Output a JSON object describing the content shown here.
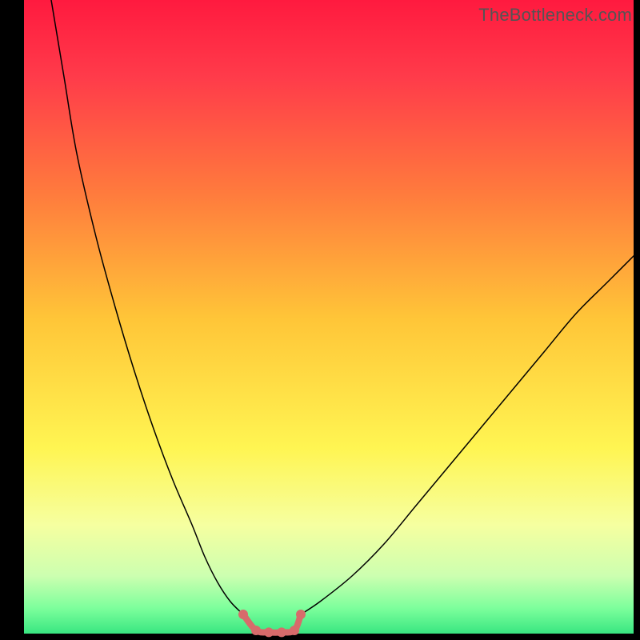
{
  "watermark": "TheBottleneck.com",
  "chart_data": {
    "type": "line",
    "title": "",
    "xlabel": "",
    "ylabel": "",
    "xlim": [
      0,
      100
    ],
    "ylim": [
      0,
      100
    ],
    "background": {
      "type": "vertical-gradient",
      "stops": [
        {
          "pos": 0.0,
          "color": "#ff1a3f"
        },
        {
          "pos": 0.12,
          "color": "#ff3b4a"
        },
        {
          "pos": 0.3,
          "color": "#ff7a3d"
        },
        {
          "pos": 0.5,
          "color": "#ffc638"
        },
        {
          "pos": 0.7,
          "color": "#fff552"
        },
        {
          "pos": 0.82,
          "color": "#f6ffa0"
        },
        {
          "pos": 0.9,
          "color": "#ccffb0"
        },
        {
          "pos": 0.95,
          "color": "#7dff9c"
        },
        {
          "pos": 1.0,
          "color": "#28e07a"
        }
      ]
    },
    "series": [
      {
        "name": "left-curve",
        "type": "line",
        "color": "#000000",
        "width": 1.5,
        "x": [
          8,
          10,
          12,
          15,
          18,
          21,
          24,
          27,
          30,
          32,
          34,
          36,
          38
        ],
        "y": [
          100,
          88,
          76,
          63,
          52,
          42,
          33,
          25,
          18,
          13,
          9,
          6,
          4
        ]
      },
      {
        "name": "right-curve",
        "type": "line",
        "color": "#000000",
        "width": 1.5,
        "x": [
          47,
          50,
          55,
          60,
          65,
          70,
          75,
          80,
          85,
          90,
          95,
          100
        ],
        "y": [
          4,
          6,
          10,
          15,
          21,
          27,
          33,
          39,
          45,
          51,
          56,
          61
        ]
      },
      {
        "name": "bottom-segment",
        "type": "line",
        "color": "#d76b6b",
        "width": 8,
        "markers": true,
        "marker_radius": 6,
        "x": [
          38,
          40,
          42,
          44,
          46,
          47
        ],
        "y": [
          4,
          1.5,
          1.2,
          1.2,
          1.5,
          4
        ]
      }
    ],
    "frame": {
      "left": true,
      "right": true,
      "top": false,
      "bottom": true,
      "color": "#000000",
      "width_left": 30,
      "width_right": 8,
      "width_bottom": 8
    }
  }
}
